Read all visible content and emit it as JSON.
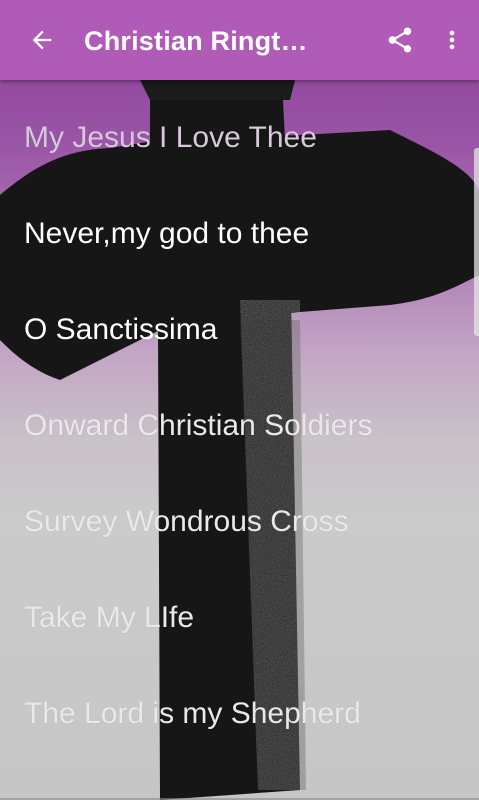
{
  "app_bar": {
    "title": "Christian Ringt…",
    "back_icon": "arrow-left-icon",
    "share_icon": "share-icon",
    "overflow_icon": "more-vert-icon",
    "background_color": "#b05bb8"
  },
  "ringtones": [
    {
      "label": "My Jesus I Love Thee",
      "color": "#d8c8dc"
    },
    {
      "label": "Never,my god to thee",
      "color": "#ffffff"
    },
    {
      "label": "O Sanctissima",
      "color": "#ffffff"
    },
    {
      "label": "Onward Christian Soldiers",
      "color": "#e9e9e9"
    },
    {
      "label": "Survey Wondrous Cross",
      "color": "#e9e9e9"
    },
    {
      "label": "Take My LIfe",
      "color": "#e9e9e9"
    },
    {
      "label": "The Lord is my Shepherd",
      "color": "#e9e9e9"
    }
  ],
  "background": {
    "top_color": "#8b3f98",
    "bottom_color": "#c6c6c6",
    "cross_color": "#161616"
  }
}
